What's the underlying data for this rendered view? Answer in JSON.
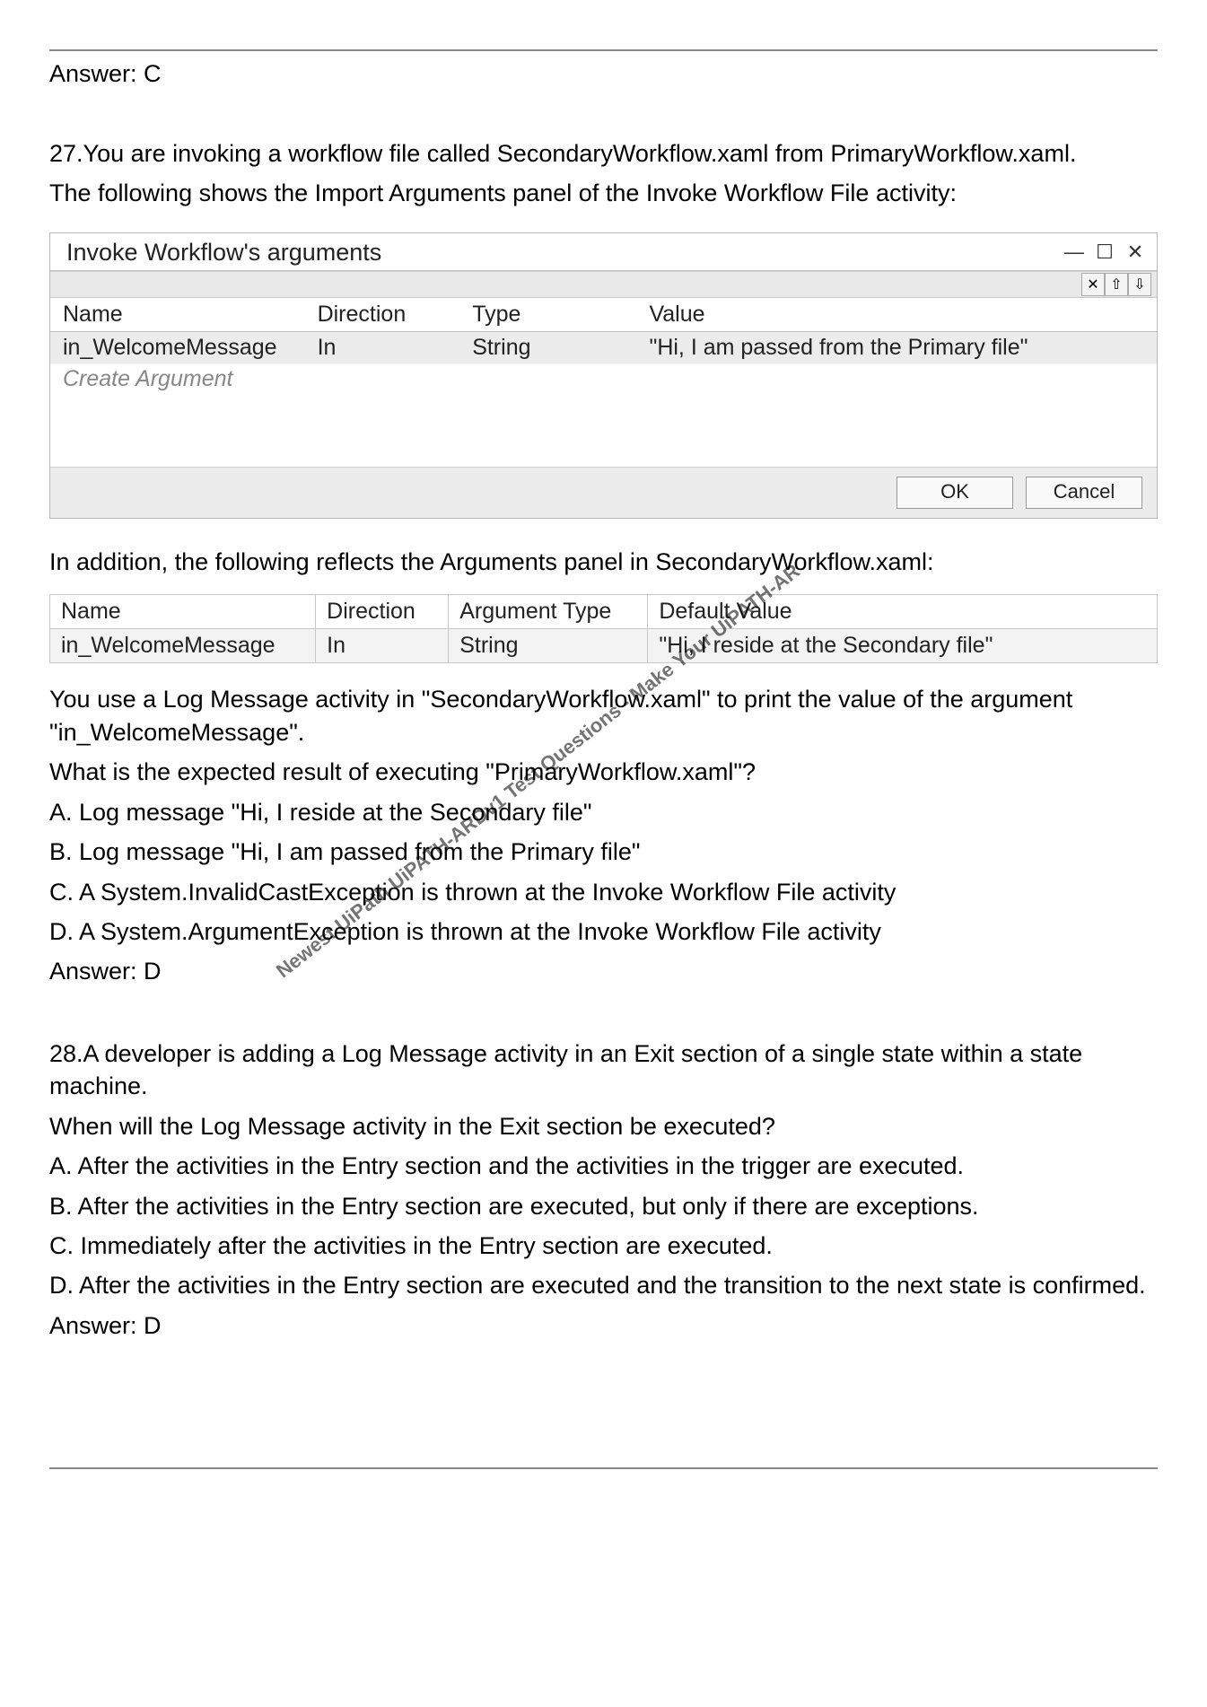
{
  "top": {
    "answer": "Answer: C"
  },
  "q27": {
    "line1": "27.You are invoking a workflow file called SecondaryWorkflow.xaml from PrimaryWorkflow.xaml.",
    "line2": "The following shows the Import Arguments panel of the Invoke Workflow File activity:",
    "dialog": {
      "title": "Invoke Workflow's arguments",
      "headers": {
        "name": "Name",
        "direction": "Direction",
        "type": "Type",
        "value": "Value"
      },
      "row1": {
        "name": "in_WelcomeMessage",
        "direction": "In",
        "type": "String",
        "value": "\"Hi, I am passed from the Primary file\""
      },
      "placeholder": "Create Argument",
      "ok": "OK",
      "cancel": "Cancel"
    },
    "line3": "In addition, the following reflects the Arguments panel in SecondaryWorkflow.xaml:",
    "table2": {
      "headers": {
        "name": "Name",
        "direction": "Direction",
        "type": "Argument Type",
        "value": "Default Value"
      },
      "row1": {
        "name": "in_WelcomeMessage",
        "direction": "In",
        "type": "String",
        "value": "\"Hi, I reside at the Secondary file\""
      }
    },
    "line4": "You use a Log Message activity in \"SecondaryWorkflow.xaml\" to print the value of the argument \"in_WelcomeMessage\".",
    "line5": "What is the expected result of executing \"PrimaryWorkflow.xaml\"?",
    "optA": "A. Log message \"Hi, I reside at the Secondary file\"",
    "optB": "B. Log message \"Hi, I am passed from the Primary file\"",
    "optC": "C. A System.InvalidCastException is thrown at the Invoke Workflow File activity",
    "optD": "D. A System.ArgumentException is thrown at the Invoke Workflow File activity",
    "answer": "Answer: D"
  },
  "watermark": "Newest UiPath UiPATH-ARDv1 Test Questions - Make Your UiPATH-AR",
  "q28": {
    "line1": "28.A developer is adding a Log Message activity in an Exit section of a single state within a state machine.",
    "line2": "When will the Log Message activity in the Exit section be executed?",
    "optA": "A. After the activities in the Entry section and the activities in the trigger are executed.",
    "optB": "B. After the activities in the Entry section are executed, but only if there are exceptions.",
    "optC": "C. Immediately after the activities in the Entry section are executed.",
    "optD": "D. After the activities in the Entry section are executed and the transition to the next state is confirmed.",
    "answer": "Answer: D"
  }
}
